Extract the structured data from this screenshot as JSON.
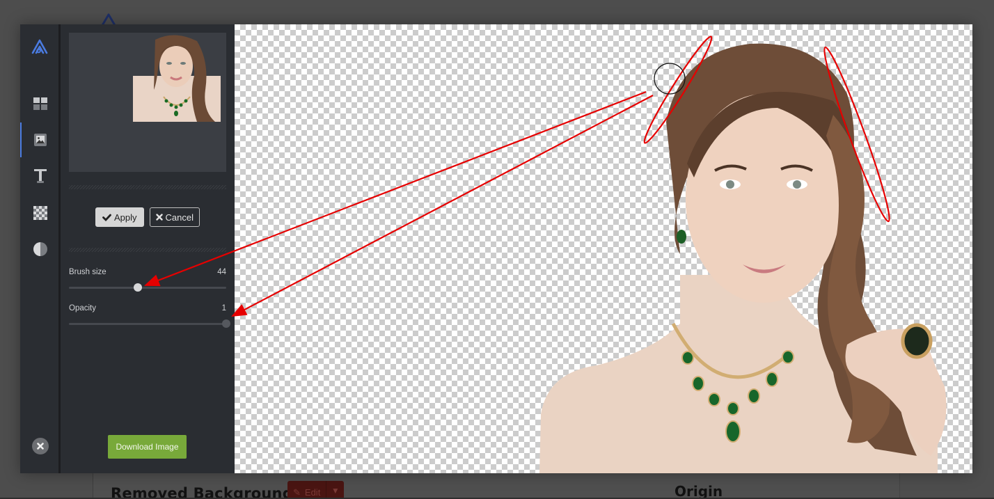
{
  "background_page": {
    "section_left_title": "Removed Background",
    "edit_button_label": "Edit",
    "edit_dropdown_icon": "caret-down-icon",
    "section_right_title": "Origin"
  },
  "editor": {
    "rail": {
      "logo": "brand-logo-icon",
      "items": [
        {
          "id": "layouts",
          "icon": "grid-icon",
          "active": false
        },
        {
          "id": "image",
          "icon": "image-icon",
          "active": true
        },
        {
          "id": "text",
          "icon": "text-icon",
          "active": false
        },
        {
          "id": "transparency",
          "icon": "checkerboard-icon",
          "active": false
        },
        {
          "id": "filters",
          "icon": "contrast-icon",
          "active": false
        }
      ],
      "close_icon": "close-icon"
    },
    "panel": {
      "apply_label": "Apply",
      "cancel_label": "Cancel",
      "brush_size": {
        "label": "Brush size",
        "value": "44",
        "fraction": 0.44
      },
      "opacity": {
        "label": "Opacity",
        "value": "1",
        "fraction": 1.0
      },
      "download_label": "Download Image"
    },
    "colors": {
      "accent": "#4a7be0",
      "download": "#78a93a",
      "annotation": "#e60000",
      "rail_bg": "#2a2d32"
    }
  }
}
